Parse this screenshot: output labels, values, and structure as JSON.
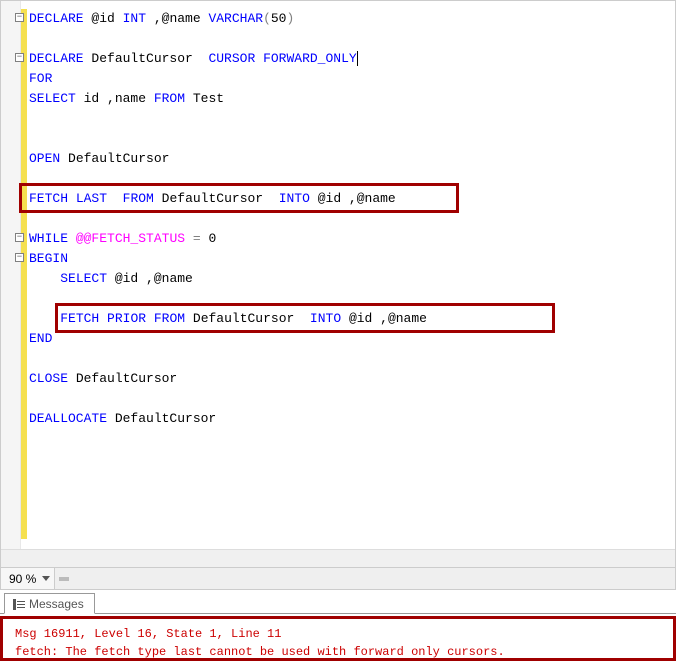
{
  "zoom": {
    "value": "90 %"
  },
  "tabs": {
    "messages_label": "Messages"
  },
  "code": {
    "l1": {
      "kw1": "DECLARE",
      "var1": " @id ",
      "typ1": "INT",
      "comma": " ,",
      "var2": "@name ",
      "typ2": "VARCHAR",
      "p1": "(",
      "num": "50",
      "p2": ")"
    },
    "l3": {
      "kw1": "DECLARE",
      "name": " DefaultCursor  ",
      "kw2": "CURSOR",
      "sp": " ",
      "kw3": "FORWARD_ONLY"
    },
    "l4": {
      "kw1": "FOR"
    },
    "l5": {
      "kw1": "SELECT",
      "cols": " id ,name ",
      "kw2": "FROM",
      "tbl": " Test"
    },
    "l8": {
      "kw1": "OPEN",
      "name": " DefaultCursor"
    },
    "l10": {
      "kw1": "FETCH",
      "sp1": " ",
      "kw2": "LAST",
      "sp2": "  ",
      "kw3": "FROM",
      "name": " DefaultCursor  ",
      "kw4": "INTO",
      "vars": " @id ,@name"
    },
    "l12": {
      "kw1": "WHILE",
      "sp": " ",
      "sys": "@@FETCH_STATUS",
      "eq": " = ",
      "num": "0"
    },
    "l13": {
      "kw1": "BEGIN"
    },
    "l14": {
      "pad": "    ",
      "kw1": "SELECT",
      "vars": " @id ,@name"
    },
    "l16": {
      "pad": "    ",
      "kw1": "FETCH",
      "sp1": " ",
      "kw2": "PRIOR",
      "sp2": " ",
      "kw3": "FROM",
      "name": " DefaultCursor  ",
      "kw4": "INTO",
      "vars": " @id ,@name"
    },
    "l17": {
      "kw1": "END"
    },
    "l19": {
      "kw1": "CLOSE",
      "name": " DefaultCursor"
    },
    "l21": {
      "kw1": "DEALLOCATE",
      "name": " DefaultCursor"
    }
  },
  "messages": {
    "line1": "Msg 16911, Level 16, State 1, Line 11",
    "line2": "fetch: The fetch type last cannot be used with forward only cursors."
  }
}
